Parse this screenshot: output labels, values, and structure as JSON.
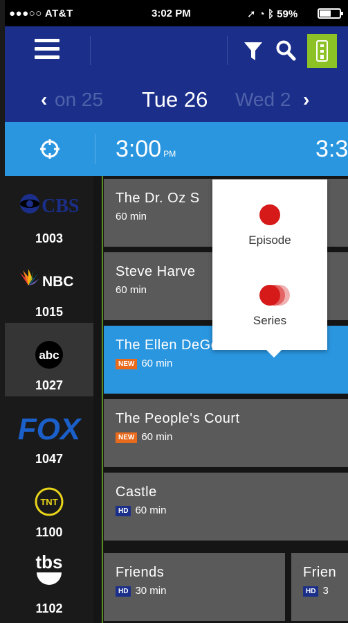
{
  "status_bar": {
    "carrier": "●●●○○ AT&T",
    "time": "3:02 PM",
    "battery": "59%",
    "battery_level": 0.59
  },
  "toolbar": {
    "menu_icon": "hamburger-icon",
    "filter_icon": "filter-icon",
    "search_icon": "search-icon",
    "remote_icon": "remote-icon",
    "accent": "#8cc226"
  },
  "date_nav": {
    "previous": "on 25",
    "current": "Tue 26",
    "next": "Wed 2"
  },
  "time_bar": {
    "current_slot": "3:00",
    "current_ampm": "PM",
    "next_slot": "3:3"
  },
  "channels": [
    {
      "logo": "CBS",
      "number": "1003"
    },
    {
      "logo": "NBC",
      "number": "1015"
    },
    {
      "logo": "abc",
      "number": "1027"
    },
    {
      "logo": "FOX",
      "number": "1047"
    },
    {
      "logo": "TNT",
      "number": "1100"
    },
    {
      "logo": "tbs",
      "number": "1102"
    }
  ],
  "programs": [
    {
      "title": "The Dr. Oz S",
      "badge": "",
      "duration": "60 min"
    },
    {
      "title": "Steve Harve",
      "badge": "",
      "duration": "60 min"
    },
    {
      "title": "The Ellen DeGeneres Show",
      "badge": "NEW",
      "duration": "60 min"
    },
    {
      "title": "The People's Court",
      "badge": "NEW",
      "duration": "60 min"
    },
    {
      "title": "Castle",
      "badge": "HD",
      "duration": "60 min"
    },
    {
      "title": "Friends",
      "badge": "HD",
      "duration": "30 min"
    },
    {
      "title": "Frien",
      "badge": "HD",
      "duration": "3"
    }
  ],
  "record_popover": {
    "episode_label": "Episode",
    "series_label": "Series"
  },
  "colors": {
    "header_blue": "#1b2f8a",
    "time_blue": "#2a96e0",
    "record_red": "#d61a1a",
    "new_badge": "#e86a1c"
  }
}
